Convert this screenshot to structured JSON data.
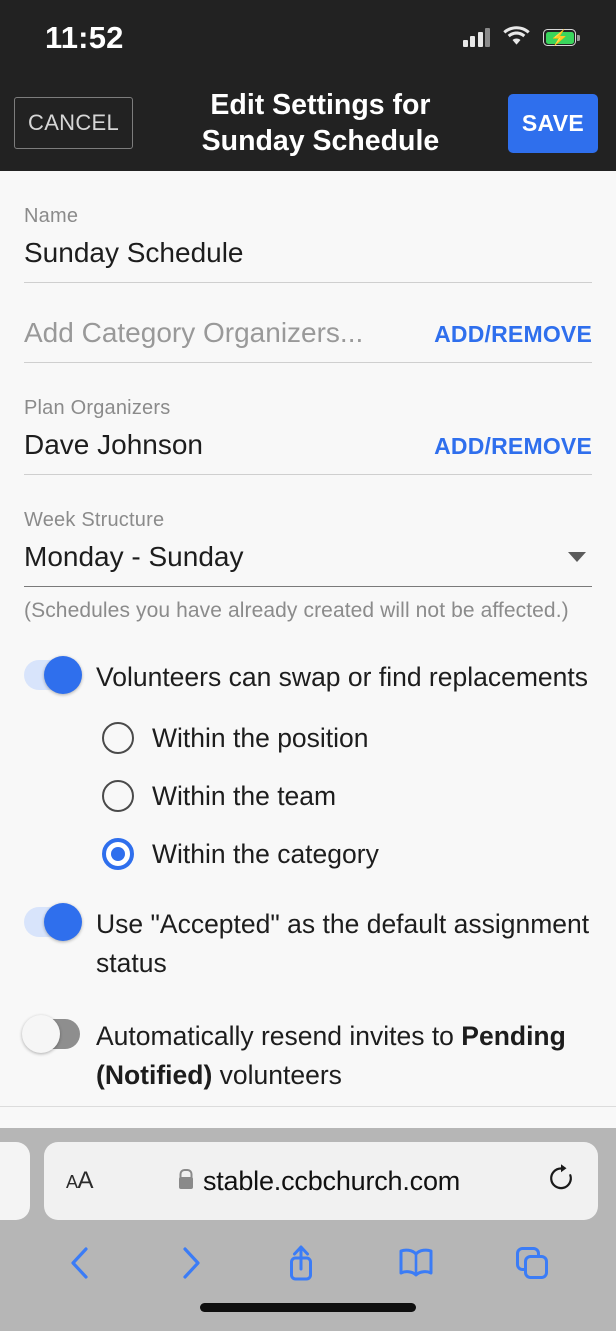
{
  "status_bar": {
    "time": "11:52",
    "signal_icon": "cellular-signal-icon",
    "signal_bars_filled": 3,
    "signal_bars_total": 4,
    "wifi_icon": "wifi-icon",
    "battery_icon": "battery-charging-icon",
    "battery_charging": true,
    "battery_color": "#3ad55c"
  },
  "navbar": {
    "cancel_label": "CANCEL",
    "title_line1": "Edit Settings for",
    "title_line2": "Sunday Schedule",
    "save_label": "SAVE",
    "save_color": "#2f6fed",
    "background": "#222222"
  },
  "form": {
    "name_field": {
      "label": "Name",
      "value": "Sunday Schedule"
    },
    "category_organizers": {
      "placeholder": "Add Category Organizers...",
      "action_label": "ADD/REMOVE"
    },
    "plan_organizers": {
      "label": "Plan Organizers",
      "value": "Dave Johnson",
      "action_label": "ADD/REMOVE"
    },
    "week_structure": {
      "label": "Week Structure",
      "value": "Monday - Sunday",
      "caret_icon": "chevron-down-icon",
      "hint": "(Schedules you have already created will not be affected.)"
    }
  },
  "settings": {
    "swap_toggle": {
      "label": "Volunteers can swap or find replacements",
      "state": "on"
    },
    "swap_scope_options": [
      {
        "label": "Within the position",
        "selected": false
      },
      {
        "label": "Within the team",
        "selected": false
      },
      {
        "label": "Within the category",
        "selected": true
      }
    ],
    "accepted_toggle": {
      "label": "Use \"Accepted\" as the default assignment status",
      "state": "on"
    },
    "resend_toggle": {
      "label_part1": "Automatically resend invites to ",
      "label_bold1": "Pending (Notified)",
      "label_part2": " volunteers",
      "state": "off"
    },
    "accent_color": "#2f6fed"
  },
  "browser": {
    "text_size_label": "AA",
    "lock_icon": "lock-icon",
    "url": "stable.ccbchurch.com",
    "reload_icon": "reload-icon",
    "toolbar": [
      {
        "name": "back-button",
        "icon": "chevron-left-icon"
      },
      {
        "name": "forward-button",
        "icon": "chevron-right-icon"
      },
      {
        "name": "share-button",
        "icon": "share-icon"
      },
      {
        "name": "bookmarks-button",
        "icon": "book-icon"
      },
      {
        "name": "tabs-button",
        "icon": "tabs-icon"
      }
    ],
    "tint_color": "#3b7cf6"
  }
}
